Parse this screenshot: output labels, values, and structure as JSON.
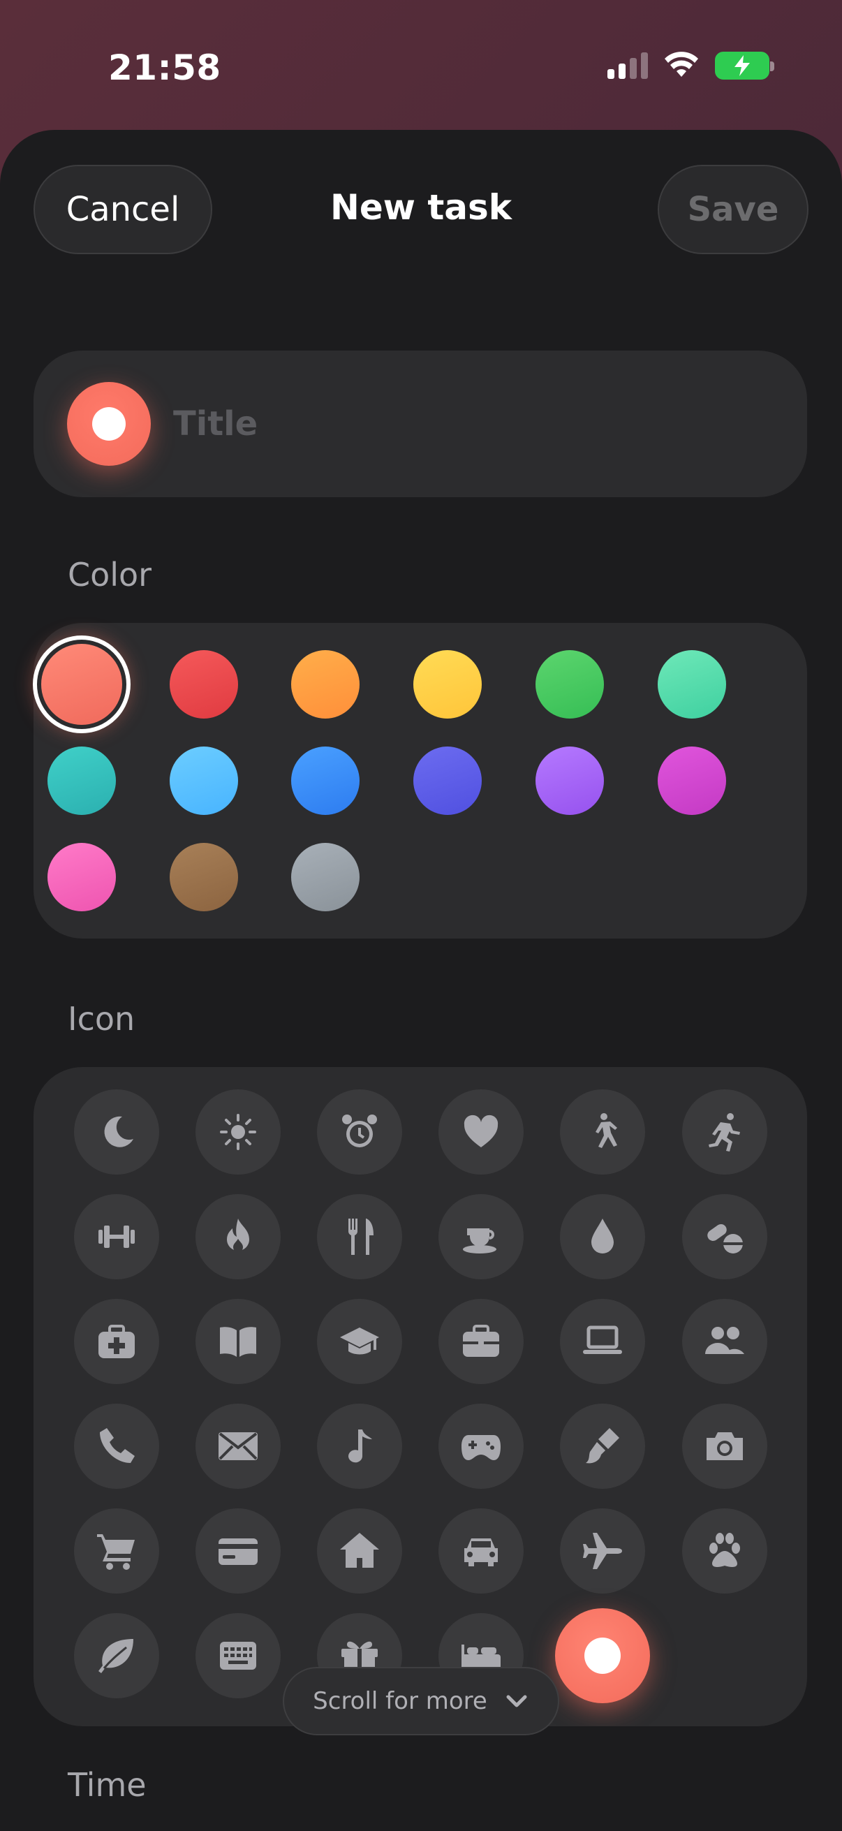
{
  "status_bar": {
    "time": "21:58"
  },
  "nav": {
    "cancel_label": "Cancel",
    "title": "New task",
    "save_label": "Save"
  },
  "title_field": {
    "placeholder": "Title",
    "value": ""
  },
  "color_section": {
    "label": "Color",
    "selected": 0,
    "swatches": [
      {
        "name": "coral",
        "c1": "#ff8a78",
        "c2": "#f06a5c"
      },
      {
        "name": "red",
        "c1": "#f5595a",
        "c2": "#e03b41"
      },
      {
        "name": "orange",
        "c1": "#ffae4a",
        "c2": "#ff8f3a"
      },
      {
        "name": "yellow",
        "c1": "#ffdb55",
        "c2": "#ffc53a"
      },
      {
        "name": "green",
        "c1": "#5cd56e",
        "c2": "#36be55"
      },
      {
        "name": "mint",
        "c1": "#6ee8b8",
        "c2": "#3fd0a0"
      },
      {
        "name": "teal",
        "c1": "#40d0c8",
        "c2": "#2bb0b0"
      },
      {
        "name": "sky",
        "c1": "#6ccdff",
        "c2": "#48b4ff"
      },
      {
        "name": "blue",
        "c1": "#4aa0ff",
        "c2": "#2d7cf0"
      },
      {
        "name": "indigo",
        "c1": "#6c6cf0",
        "c2": "#5050e0"
      },
      {
        "name": "purple",
        "c1": "#b579ff",
        "c2": "#9652ee"
      },
      {
        "name": "magenta",
        "c1": "#e055dc",
        "c2": "#c43ac4"
      },
      {
        "name": "pink",
        "c1": "#ff7ac8",
        "c2": "#ee55b0"
      },
      {
        "name": "brown",
        "c1": "#a88058",
        "c2": "#8c6440"
      },
      {
        "name": "gray",
        "c1": "#a8b0b8",
        "c2": "#8a9299"
      }
    ]
  },
  "icon_section": {
    "label": "Icon",
    "icons": [
      "moon-icon",
      "sun-icon",
      "alarm-clock-icon",
      "heart-icon",
      "walking-icon",
      "running-icon",
      "dumbbell-icon",
      "flame-icon",
      "fork-knife-icon",
      "coffee-cup-icon",
      "water-drop-icon",
      "pills-icon",
      "medical-kit-icon",
      "book-icon",
      "graduation-cap-icon",
      "briefcase-icon",
      "laptop-icon",
      "people-icon",
      "phone-icon",
      "envelope-icon",
      "music-note-icon",
      "gamepad-icon",
      "paintbrush-icon",
      "camera-icon",
      "shopping-cart-icon",
      "credit-card-icon",
      "house-icon",
      "car-icon",
      "airplane-icon",
      "paw-icon",
      "leaf-icon",
      "keyboard-icon",
      "gift-icon",
      "bed-icon",
      "selected-dot-icon"
    ],
    "selected_color": "#f36b5b"
  },
  "scroll_hint": {
    "label": "Scroll for more"
  },
  "time_section": {
    "label": "Time"
  }
}
